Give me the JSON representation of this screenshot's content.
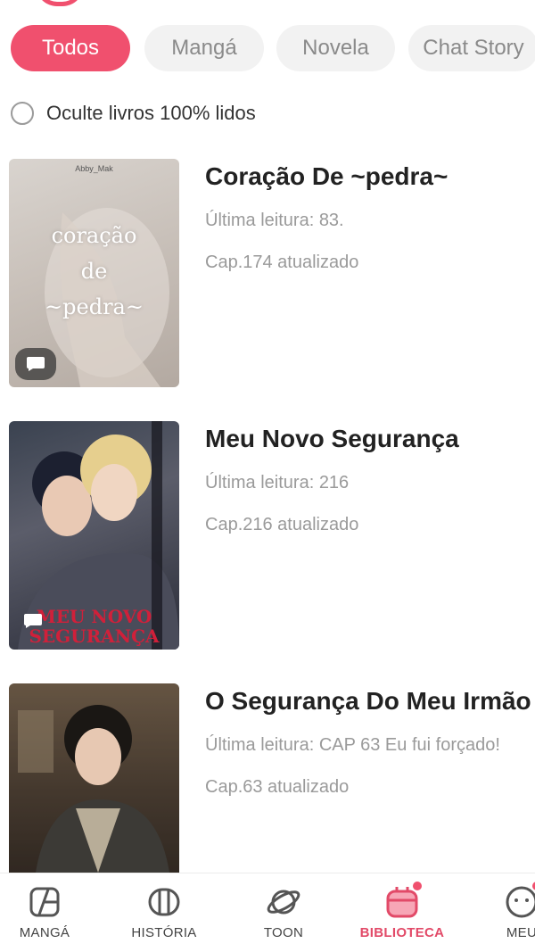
{
  "tabs": [
    {
      "label": "Todos",
      "active": true
    },
    {
      "label": "Mangá",
      "active": false
    },
    {
      "label": "Novela",
      "active": false
    },
    {
      "label": "Chat Story",
      "active": false
    }
  ],
  "filter": {
    "hide_read_label": "Oculte livros 100% lidos",
    "checked": false
  },
  "books": [
    {
      "title": "Coração De ~pedra~",
      "last_read": "Última leitura: 83.",
      "updated": "Cap.174 atualizado",
      "cover_author": "Abby_Mak",
      "cover_text": "coração de ~pedra~",
      "badge_icon": "chat-bubble-icon"
    },
    {
      "title": "Meu Novo Segurança",
      "last_read": "Última leitura: 216",
      "updated": "Cap.216 atualizado",
      "cover_text": "MEU NOVO SEGURANÇA",
      "badge_icon": "chat-bubble-icon"
    },
    {
      "title": "O Segurança Do Meu Irmão",
      "last_read": "Última leitura: CAP 63 Eu fui forçado!",
      "updated": "Cap.63 atualizado"
    }
  ],
  "nav": [
    {
      "label": "MANGÁ",
      "icon": "manga-icon",
      "active": false
    },
    {
      "label": "HISTÓRIA",
      "icon": "story-book-icon",
      "active": false
    },
    {
      "label": "TOON",
      "icon": "planet-icon",
      "active": false
    },
    {
      "label": "BIBLIOTECA",
      "icon": "library-box-icon",
      "active": true,
      "notification_dot": true
    },
    {
      "label": "MEU",
      "icon": "profile-face-icon",
      "active": false,
      "notification_dot": true
    }
  ],
  "colors": {
    "accent": "#f0506e",
    "muted_text": "#9a9a9a",
    "chip_bg": "#f2f2f2"
  }
}
